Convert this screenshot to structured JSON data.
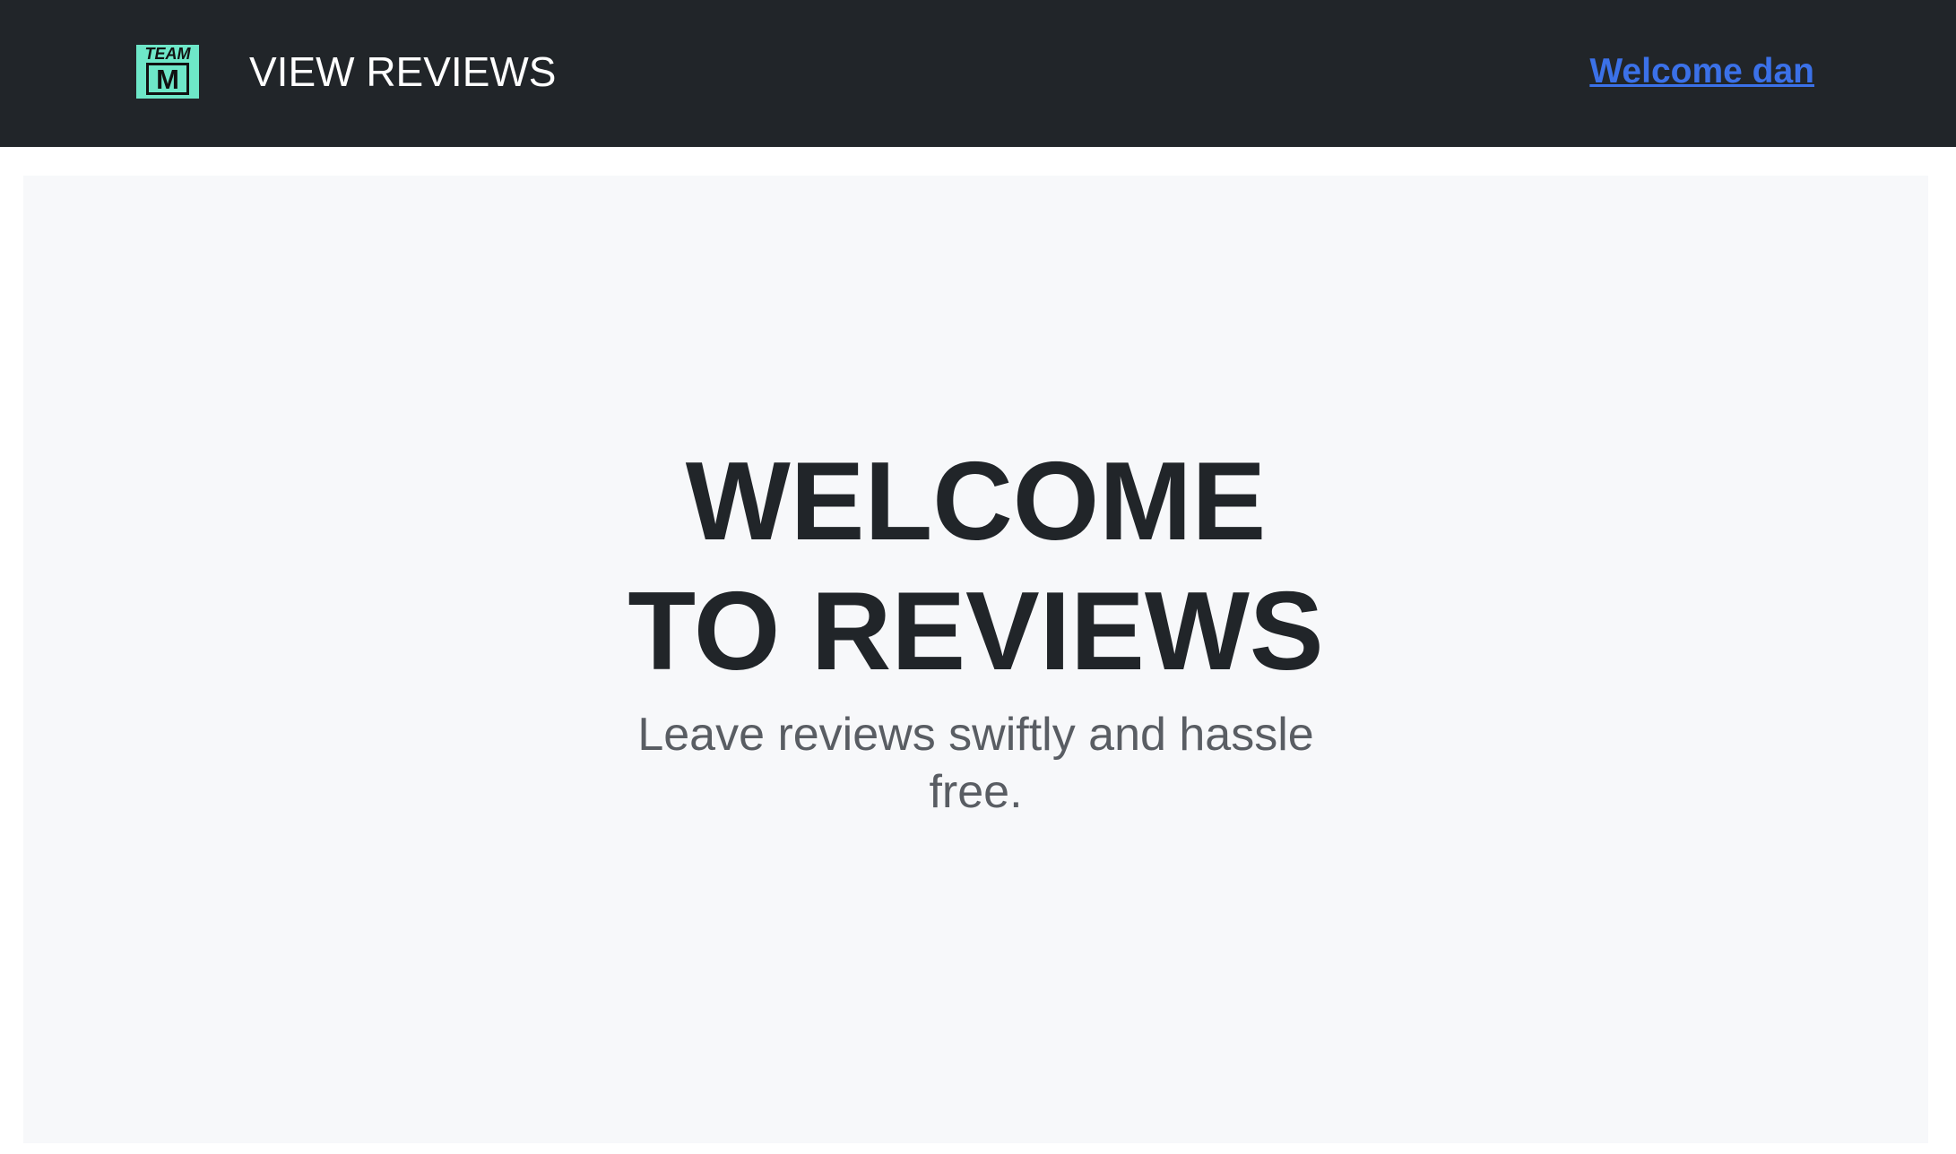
{
  "header": {
    "logo": {
      "top_text": "TEAM",
      "letter": "M",
      "color": "#6ee7c8"
    },
    "title": "VIEW REVIEWS",
    "welcome_link": "Welcome dan",
    "background": "#212529",
    "link_color": "#3b71e8"
  },
  "hero": {
    "heading_line1": "WELCOME",
    "heading_line2": "TO REVIEWS",
    "subtitle_line1": "Leave reviews swiftly and hassle",
    "subtitle_line2": "free.",
    "background": "#f7f8fa"
  }
}
